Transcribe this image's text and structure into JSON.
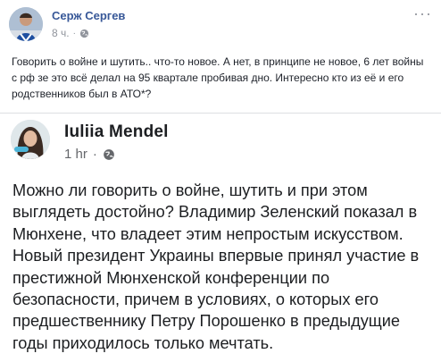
{
  "outer_post": {
    "author": "Серж Сергев",
    "time": "8 ч.",
    "separator": "·",
    "privacy_icon": "globe-icon",
    "more_icon": "more-options-icon",
    "text": "Говорить о войне и шутить.. что-то новое. А нет, в принципе не новое, 6 лет войны с рф зе это всё делал на 95 квартале пробивая дно. Интересно кто из её и его родственников был в АТО*?"
  },
  "shared_post": {
    "author": "Iuliia Mendel",
    "time": "1 hr",
    "separator": "·",
    "privacy_icon": "globe-icon",
    "text": "Можно ли говорить о войне, шутить и при этом выглядеть достойно? Владимир Зеленский показал в Мюнхене, что владеет этим непростым искусством. Новый президент Украины впервые принял участие в престижной Мюнхенской конференции по безопасности, причем в условиях, о которых его предшественнику Петру Порошенко в предыдущие годы приходилось только мечтать."
  },
  "colors": {
    "link_blue": "#385898",
    "meta_gray": "#90949c",
    "text": "#1c1e21"
  }
}
